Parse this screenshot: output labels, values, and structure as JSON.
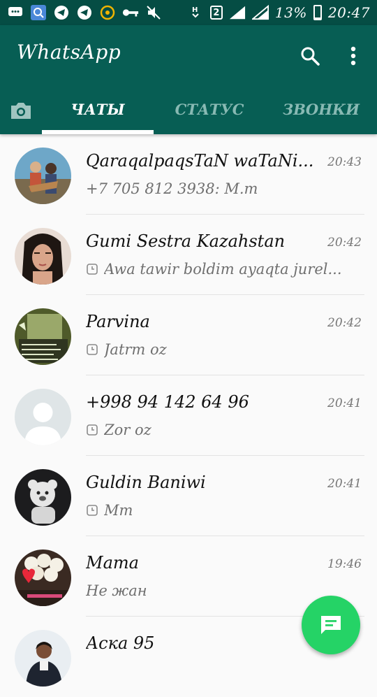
{
  "status_bar": {
    "battery_percent": "13%",
    "battery_level": 0.13,
    "time": "20:47",
    "sim": "2",
    "network": "H",
    "icons": [
      "chat-bubble-icon",
      "search-app-icon",
      "telegram-icon",
      "telegram-icon",
      "notification-icon",
      "key-icon",
      "mute-icon",
      "network-h-icon",
      "sim2-icon",
      "signal-icon",
      "signal-icon",
      "battery-icon"
    ]
  },
  "app_bar": {
    "title": "WhatsApp",
    "search_icon": "search-icon",
    "menu_icon": "more-vert-icon",
    "color": "#075e54"
  },
  "tabs": {
    "camera_icon": "camera-icon",
    "items": [
      {
        "label": "ЧАТЫ",
        "active": true
      },
      {
        "label": "СТАТУС",
        "active": false
      },
      {
        "label": "ЗВОНКИ",
        "active": false
      }
    ]
  },
  "chats": [
    {
      "name": "QaraqalpaqsTaN waTaNi...",
      "time": "20:43",
      "message": "+7 705 812 3938: M.m",
      "pending": false,
      "avatar": "couple-photo"
    },
    {
      "name": "Gumi Sestra Kazahstan",
      "time": "20:42",
      "message": "Awa tawir boldim ayaqta jurel...",
      "pending": true,
      "avatar": "woman-photo"
    },
    {
      "name": "Parvina",
      "time": "20:42",
      "message": "Jatrm oz",
      "pending": true,
      "avatar": "text-photo"
    },
    {
      "name": "+998 94 142 64 96",
      "time": "20:41",
      "message": "Zor oz",
      "pending": true,
      "avatar": "default-avatar"
    },
    {
      "name": "Guldin Baniwi",
      "time": "20:41",
      "message": "Mm",
      "pending": true,
      "avatar": "teddy-photo"
    },
    {
      "name": "Mama",
      "time": "19:46",
      "message": "Не жан",
      "pending": false,
      "avatar": "flowers-photo"
    },
    {
      "name": "Аска 95",
      "time": "",
      "message": "",
      "pending": false,
      "avatar": "man-photo"
    }
  ],
  "fab": {
    "icon": "new-chat-icon",
    "color": "#25d366"
  }
}
